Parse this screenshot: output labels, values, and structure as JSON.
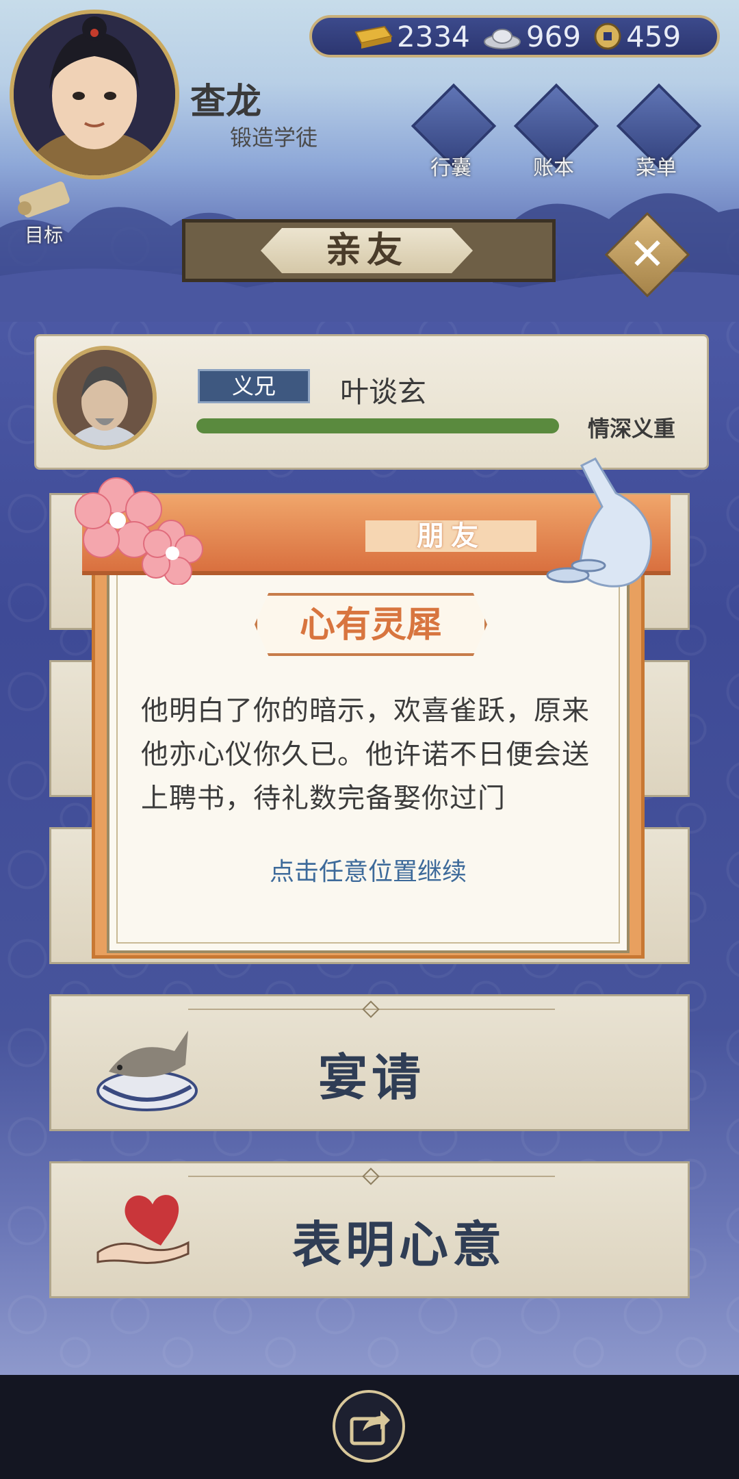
{
  "currency": {
    "gold": "2334",
    "silver": "969",
    "coin": "459"
  },
  "player": {
    "name": "查龙",
    "title": "锻造学徒"
  },
  "top_buttons": {
    "bag": "行囊",
    "ledger": "账本",
    "menu": "菜单"
  },
  "goal_label": "目标",
  "page_title": "亲友",
  "friend": {
    "relation": "义兄",
    "name": "叶谈玄",
    "bond_status": "情深义重",
    "bond_level": 1.0
  },
  "actions": {
    "feast": "宴请",
    "confess": "表明心意"
  },
  "modal": {
    "category": "朋友",
    "heading": "心有灵犀",
    "message": "他明白了你的暗示，欢喜雀跃，原来他亦心仪你久已。他许诺不日便会送上聘书，待礼数完备娶你过门",
    "continue_hint": "点击任意位置继续"
  },
  "colors": {
    "accent_orange": "#d8753f",
    "bond_green": "#5a8a3e",
    "relation_blue": "#3e5880"
  }
}
